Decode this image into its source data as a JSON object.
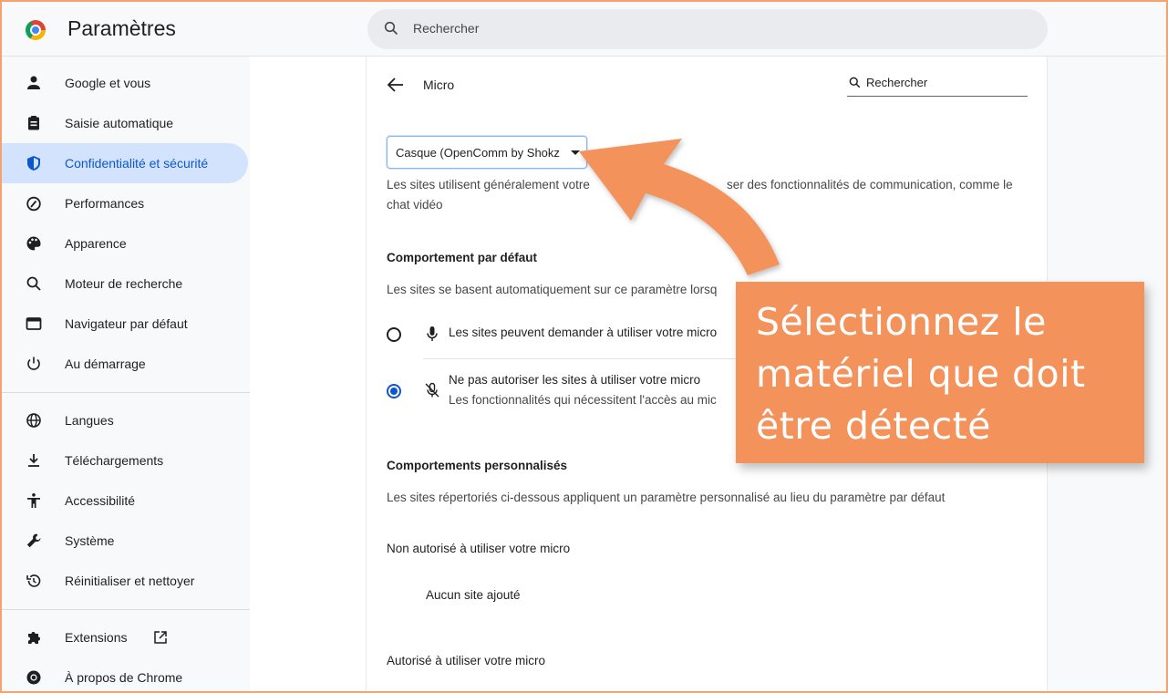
{
  "app": {
    "title": "Paramètres"
  },
  "top_search": {
    "placeholder": "Rechercher"
  },
  "sidebar": {
    "items": [
      {
        "label": "Google et vous",
        "icon": "person-icon"
      },
      {
        "label": "Saisie automatique",
        "icon": "clipboard-icon"
      },
      {
        "label": "Confidentialité et sécurité",
        "icon": "shield-icon",
        "active": true
      },
      {
        "label": "Performances",
        "icon": "speedometer-icon"
      },
      {
        "label": "Apparence",
        "icon": "palette-icon"
      },
      {
        "label": "Moteur de recherche",
        "icon": "search-icon"
      },
      {
        "label": "Navigateur par défaut",
        "icon": "browser-icon"
      },
      {
        "label": "Au démarrage",
        "icon": "power-icon"
      },
      {
        "label": "Langues",
        "icon": "globe-icon"
      },
      {
        "label": "Téléchargements",
        "icon": "download-icon"
      },
      {
        "label": "Accessibilité",
        "icon": "accessibility-icon"
      },
      {
        "label": "Système",
        "icon": "wrench-icon"
      },
      {
        "label": "Réinitialiser et nettoyer",
        "icon": "restore-icon"
      },
      {
        "label": "Extensions",
        "icon": "puzzle-icon"
      },
      {
        "label": "À propos de Chrome",
        "icon": "chrome-icon"
      }
    ]
  },
  "page": {
    "title": "Micro",
    "search_placeholder": "Rechercher",
    "device": {
      "selected": "Casque (OpenComm by Shokz"
    },
    "description_line1": "Les sites utilisent généralement votre",
    "description_line1_end": "ser des fonctionnalités de communication, comme le",
    "description_line2": "chat vidéo",
    "default_heading": "Comportement par défaut",
    "default_desc": "Les sites se basent automatiquement sur ce paramètre lorsq",
    "option_ask": "Les sites peuvent demander à utiliser votre micro",
    "option_block": "Ne pas autoriser les sites à utiliser votre micro",
    "option_block_desc": "Les fonctionnalités qui nécessitent l'accès au mic",
    "custom_heading": "Comportements personnalisés",
    "custom_desc": "Les sites répertoriés ci-dessous appliquent un paramètre personnalisé au lieu du paramètre par défaut",
    "blocked_label": "Non autorisé à utiliser votre micro",
    "no_site": "Aucun site ajouté",
    "allowed_label": "Autorisé à utiliser votre micro"
  },
  "callout": {
    "line1": "Sélectionnez le",
    "line2": "matériel que doit",
    "line3": "être détecté"
  },
  "colors": {
    "accent": "#0b57d0",
    "active_bg": "#d3e3fd",
    "callout": "#f4925c"
  }
}
